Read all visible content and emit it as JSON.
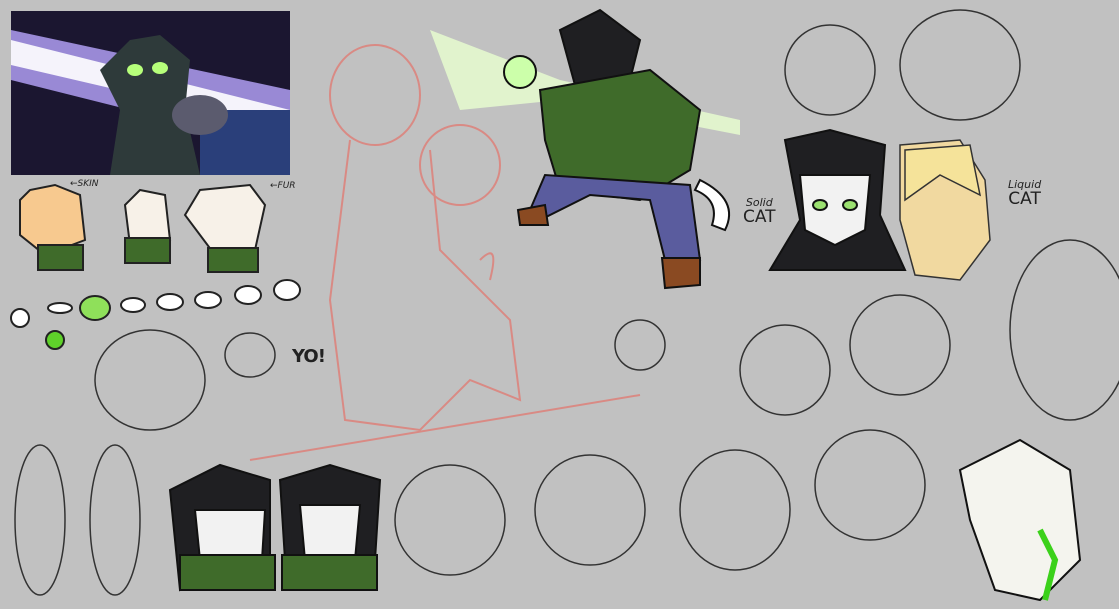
{
  "labels": {
    "skin": "←SKIN",
    "fur": "←FUR",
    "yo": "YO!",
    "solid_top": "Solid",
    "solid_bottom": "CAT",
    "liquid_top": "Liquid",
    "liquid_bottom": "CAT"
  },
  "colors": {
    "background": "#c1c1c1",
    "jacket": "#3f6b2a",
    "pants": "#5a5c9e",
    "glow": "#9aff6a",
    "sketch_red": "#d98a84",
    "panel_dark": "#1b1630"
  }
}
